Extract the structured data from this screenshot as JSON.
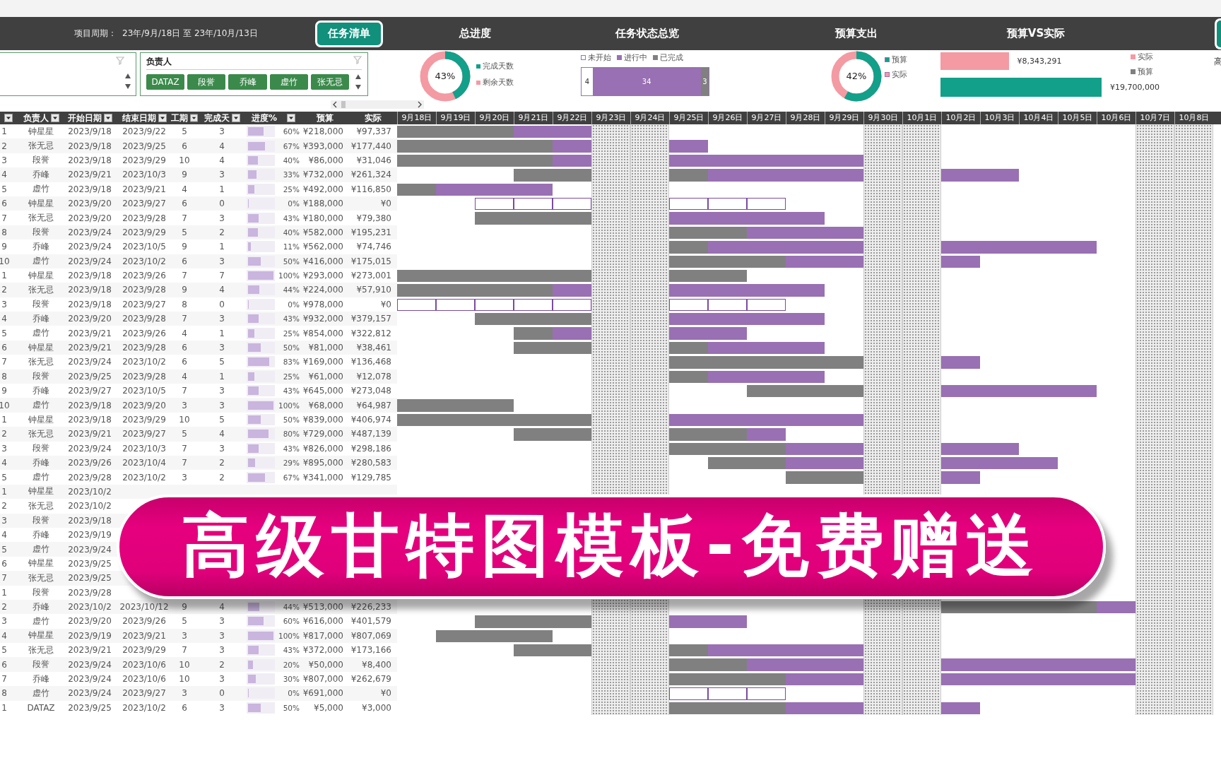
{
  "header": {
    "period_label": "项目周期：",
    "period_value": "23年/9月/18日 至 23年/10月/13日",
    "task_list_button": "任务清单",
    "section_titles": [
      "总进度",
      "任务状态总览",
      "预算支出",
      "预算VS实际"
    ]
  },
  "slicer": {
    "title": "负责人",
    "items": [
      {
        "label": "DATAZ",
        "selected": true
      },
      {
        "label": "段誉",
        "selected": true
      },
      {
        "label": "乔峰",
        "selected": true
      },
      {
        "label": "虚竹",
        "selected": true
      },
      {
        "label": "张无忌",
        "selected": true
      }
    ]
  },
  "progress": {
    "label": "43%",
    "level": 0.43,
    "legend": [
      {
        "label": "完成天数",
        "color": "#12a08a"
      },
      {
        "label": "剩余天数",
        "color": "#f49aa3"
      }
    ]
  },
  "status_overview": {
    "segments": [
      {
        "label": "未开始",
        "count": "4",
        "color": "#ffffff"
      },
      {
        "label": "进行中",
        "count": "34",
        "color": "#9970b3"
      },
      {
        "label": "已完成",
        "count": "3",
        "color": "#808080"
      }
    ]
  },
  "budget_spend": {
    "label": "42%",
    "level": 0.58,
    "legend": [
      {
        "label": "预算",
        "color": "#12a08a"
      },
      {
        "label": "实际",
        "color": "#f49aa3"
      }
    ]
  },
  "budget_vs_actual": {
    "bars": [
      {
        "value": "¥8,343,291",
        "color": "#f49aa3"
      },
      {
        "value": "¥19,700,000",
        "color": "#12a08a"
      }
    ],
    "legend": [
      {
        "label": "实际",
        "color": "#f49aa3"
      },
      {
        "label": "预算",
        "color": "#808080"
      }
    ]
  },
  "right_edge_text": "高",
  "table": {
    "columns": [
      {
        "filter": true
      },
      {
        "label": "负责人",
        "filter": true
      },
      {
        "label": "开始日期",
        "filter": true
      },
      {
        "label": "结束日期",
        "filter": true
      },
      {
        "label": "工期",
        "filter": true
      },
      {
        "label": "完成天",
        "filter": true
      },
      {
        "label": "进度%",
        "filter": true
      },
      {
        "label": "预算",
        "filter": false
      },
      {
        "label": "实际",
        "filter": false
      }
    ],
    "rows": [
      {
        "no": "1",
        "owner": "钟星星",
        "start": "2023/9/18",
        "end": "2023/9/22",
        "duration": "5",
        "done": "3",
        "progress": "60%",
        "level": 0.6,
        "budget": "¥218,000",
        "actual": "¥97,337"
      },
      {
        "no": "2",
        "owner": "张无忌",
        "start": "2023/9/18",
        "end": "2023/9/25",
        "duration": "6",
        "done": "4",
        "progress": "67%",
        "level": 0.67,
        "budget": "¥393,000",
        "actual": "¥177,440"
      },
      {
        "no": "3",
        "owner": "段誉",
        "start": "2023/9/18",
        "end": "2023/9/29",
        "duration": "10",
        "done": "4",
        "progress": "40%",
        "level": 0.4,
        "budget": "¥86,000",
        "actual": "¥31,046"
      },
      {
        "no": "4",
        "owner": "乔峰",
        "start": "2023/9/21",
        "end": "2023/10/3",
        "duration": "9",
        "done": "3",
        "progress": "33%",
        "level": 0.33,
        "budget": "¥732,000",
        "actual": "¥261,324"
      },
      {
        "no": "5",
        "owner": "虚竹",
        "start": "2023/9/18",
        "end": "2023/9/21",
        "duration": "4",
        "done": "1",
        "progress": "25%",
        "level": 0.25,
        "budget": "¥492,000",
        "actual": "¥116,850"
      },
      {
        "no": "6",
        "owner": "钟星星",
        "start": "2023/9/20",
        "end": "2023/9/27",
        "duration": "6",
        "done": "0",
        "progress": "0%",
        "level": 0,
        "budget": "¥188,000",
        "actual": "¥0"
      },
      {
        "no": "7",
        "owner": "张无忌",
        "start": "2023/9/20",
        "end": "2023/9/28",
        "duration": "7",
        "done": "3",
        "progress": "43%",
        "level": 0.43,
        "budget": "¥180,000",
        "actual": "¥79,380"
      },
      {
        "no": "8",
        "owner": "段誉",
        "start": "2023/9/24",
        "end": "2023/9/29",
        "duration": "5",
        "done": "2",
        "progress": "40%",
        "level": 0.4,
        "budget": "¥582,000",
        "actual": "¥195,231"
      },
      {
        "no": "9",
        "owner": "乔峰",
        "start": "2023/9/24",
        "end": "2023/10/5",
        "duration": "9",
        "done": "1",
        "progress": "11%",
        "level": 0.11,
        "budget": "¥562,000",
        "actual": "¥74,746"
      },
      {
        "no": "10",
        "owner": "虚竹",
        "start": "2023/9/24",
        "end": "2023/10/2",
        "duration": "6",
        "done": "3",
        "progress": "50%",
        "level": 0.5,
        "budget": "¥416,000",
        "actual": "¥175,015"
      },
      {
        "no": "1",
        "owner": "钟星星",
        "start": "2023/9/18",
        "end": "2023/9/26",
        "duration": "7",
        "done": "7",
        "progress": "100%",
        "level": 1,
        "budget": "¥293,000",
        "actual": "¥273,001"
      },
      {
        "no": "2",
        "owner": "张无忌",
        "start": "2023/9/18",
        "end": "2023/9/28",
        "duration": "9",
        "done": "4",
        "progress": "44%",
        "level": 0.44,
        "budget": "¥224,000",
        "actual": "¥57,910"
      },
      {
        "no": "3",
        "owner": "段誉",
        "start": "2023/9/18",
        "end": "2023/9/27",
        "duration": "8",
        "done": "0",
        "progress": "0%",
        "level": 0,
        "budget": "¥978,000",
        "actual": "¥0"
      },
      {
        "no": "4",
        "owner": "乔峰",
        "start": "2023/9/20",
        "end": "2023/9/28",
        "duration": "7",
        "done": "3",
        "progress": "43%",
        "level": 0.43,
        "budget": "¥932,000",
        "actual": "¥379,157"
      },
      {
        "no": "5",
        "owner": "虚竹",
        "start": "2023/9/21",
        "end": "2023/9/26",
        "duration": "4",
        "done": "1",
        "progress": "25%",
        "level": 0.25,
        "budget": "¥854,000",
        "actual": "¥322,812"
      },
      {
        "no": "6",
        "owner": "钟星星",
        "start": "2023/9/21",
        "end": "2023/9/28",
        "duration": "6",
        "done": "3",
        "progress": "50%",
        "level": 0.5,
        "budget": "¥81,000",
        "actual": "¥38,461"
      },
      {
        "no": "7",
        "owner": "张无忌",
        "start": "2023/9/24",
        "end": "2023/10/2",
        "duration": "6",
        "done": "5",
        "progress": "83%",
        "level": 0.83,
        "budget": "¥169,000",
        "actual": "¥136,468"
      },
      {
        "no": "8",
        "owner": "段誉",
        "start": "2023/9/25",
        "end": "2023/9/28",
        "duration": "4",
        "done": "1",
        "progress": "25%",
        "level": 0.25,
        "budget": "¥61,000",
        "actual": "¥12,078"
      },
      {
        "no": "9",
        "owner": "乔峰",
        "start": "2023/9/27",
        "end": "2023/10/5",
        "duration": "7",
        "done": "3",
        "progress": "43%",
        "level": 0.43,
        "budget": "¥645,000",
        "actual": "¥273,048"
      },
      {
        "no": "10",
        "owner": "虚竹",
        "start": "2023/9/18",
        "end": "2023/9/20",
        "duration": "3",
        "done": "3",
        "progress": "100%",
        "level": 1,
        "budget": "¥68,000",
        "actual": "¥64,987"
      },
      {
        "no": "1",
        "owner": "钟星星",
        "start": "2023/9/18",
        "end": "2023/9/29",
        "duration": "10",
        "done": "5",
        "progress": "50%",
        "level": 0.5,
        "budget": "¥839,000",
        "actual": "¥406,974"
      },
      {
        "no": "2",
        "owner": "张无忌",
        "start": "2023/9/21",
        "end": "2023/9/27",
        "duration": "5",
        "done": "4",
        "progress": "80%",
        "level": 0.8,
        "budget": "¥729,000",
        "actual": "¥487,139"
      },
      {
        "no": "3",
        "owner": "段誉",
        "start": "2023/9/24",
        "end": "2023/10/3",
        "duration": "7",
        "done": "3",
        "progress": "43%",
        "level": 0.43,
        "budget": "¥826,000",
        "actual": "¥298,186"
      },
      {
        "no": "4",
        "owner": "乔峰",
        "start": "2023/9/26",
        "end": "2023/10/4",
        "duration": "7",
        "done": "2",
        "progress": "29%",
        "level": 0.29,
        "budget": "¥895,000",
        "actual": "¥280,583"
      },
      {
        "no": "5",
        "owner": "虚竹",
        "start": "2023/9/28",
        "end": "2023/10/2",
        "duration": "3",
        "done": "2",
        "progress": "67%",
        "level": 0.67,
        "budget": "¥341,000",
        "actual": "¥129,785"
      },
      {
        "no": "1",
        "owner": "钟星星",
        "start": "2023/10/2"
      },
      {
        "no": "2",
        "owner": "张无忌",
        "start": "2023/10/2"
      },
      {
        "no": "3",
        "owner": "段誉",
        "start": "2023/9/18"
      },
      {
        "no": "4",
        "owner": "乔峰",
        "start": "2023/9/19"
      },
      {
        "no": "5",
        "owner": "虚竹",
        "start": "2023/9/24"
      },
      {
        "no": "6",
        "owner": "钟星星",
        "start": "2023/9/25"
      },
      {
        "no": "7",
        "owner": "张无忌",
        "start": "2023/9/25"
      },
      {
        "no": "1",
        "owner": "段誉",
        "start": "2023/9/28"
      },
      {
        "no": "2",
        "owner": "乔峰",
        "start": "2023/10/2",
        "end": "2023/10/12",
        "duration": "9",
        "done": "4",
        "progress": "44%",
        "level": 0.44,
        "budget": "¥513,000",
        "actual": "¥226,233"
      },
      {
        "no": "3",
        "owner": "虚竹",
        "start": "2023/9/20",
        "end": "2023/9/26",
        "duration": "5",
        "done": "3",
        "progress": "60%",
        "level": 0.6,
        "budget": "¥616,000",
        "actual": "¥401,579"
      },
      {
        "no": "4",
        "owner": "钟星星",
        "start": "2023/9/19",
        "end": "2023/9/21",
        "duration": "3",
        "done": "3",
        "progress": "100%",
        "level": 1,
        "budget": "¥817,000",
        "actual": "¥807,069"
      },
      {
        "no": "5",
        "owner": "张无忌",
        "start": "2023/9/21",
        "end": "2023/9/29",
        "duration": "7",
        "done": "3",
        "progress": "43%",
        "level": 0.43,
        "budget": "¥372,000",
        "actual": "¥173,166"
      },
      {
        "no": "6",
        "owner": "段誉",
        "start": "2023/9/24",
        "end": "2023/10/6",
        "duration": "10",
        "done": "2",
        "progress": "20%",
        "level": 0.2,
        "budget": "¥50,000",
        "actual": "¥8,400"
      },
      {
        "no": "7",
        "owner": "乔峰",
        "start": "2023/9/24",
        "end": "2023/10/6",
        "duration": "10",
        "done": "3",
        "progress": "30%",
        "level": 0.3,
        "budget": "¥807,000",
        "actual": "¥262,679"
      },
      {
        "no": "8",
        "owner": "虚竹",
        "start": "2023/9/24",
        "end": "2023/9/27",
        "duration": "3",
        "done": "0",
        "progress": "0%",
        "level": 0,
        "budget": "¥691,000",
        "actual": "¥0"
      },
      {
        "no": "1",
        "owner": "DATAZ",
        "start": "2023/9/25",
        "end": "2023/10/2",
        "duration": "6",
        "done": "3",
        "progress": "50%",
        "level": 0.5,
        "budget": "¥5,000",
        "actual": "¥3,000"
      }
    ]
  },
  "gantt": {
    "days": [
      {
        "label": "9月18日",
        "weekend": false
      },
      {
        "label": "9月19日",
        "weekend": false
      },
      {
        "label": "9月20日",
        "weekend": false
      },
      {
        "label": "9月21日",
        "weekend": false
      },
      {
        "label": "9月22日",
        "weekend": false
      },
      {
        "label": "9月23日",
        "weekend": true
      },
      {
        "label": "9月24日",
        "weekend": true
      },
      {
        "label": "9月25日",
        "weekend": false
      },
      {
        "label": "9月26日",
        "weekend": false
      },
      {
        "label": "9月27日",
        "weekend": false
      },
      {
        "label": "9月28日",
        "weekend": false
      },
      {
        "label": "9月29日",
        "weekend": false
      },
      {
        "label": "9月30日",
        "weekend": true
      },
      {
        "label": "10月1日",
        "weekend": true
      },
      {
        "label": "10月2日",
        "weekend": false
      },
      {
        "label": "10月3日",
        "weekend": false
      },
      {
        "label": "10月4日",
        "weekend": false
      },
      {
        "label": "10月5日",
        "weekend": false
      },
      {
        "label": "10月6日",
        "weekend": false
      },
      {
        "label": "10月7日",
        "weekend": true
      },
      {
        "label": "10月8日",
        "weekend": true
      }
    ]
  },
  "banner": {
    "text": "高级甘特图模板-免费赠送"
  }
}
